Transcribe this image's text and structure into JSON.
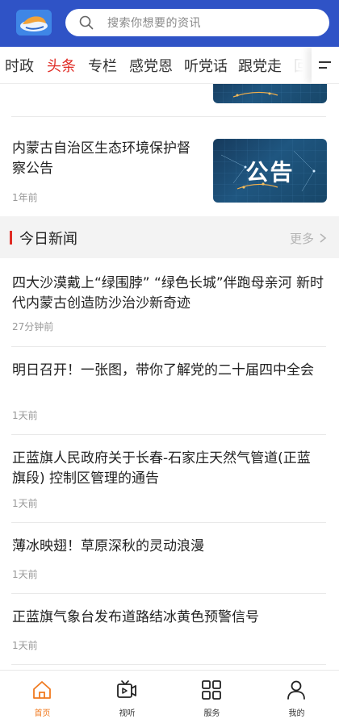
{
  "header": {
    "logo_icon": "app-logo",
    "search_placeholder": "搜索你想要的资讯",
    "search_icon": "search-icon"
  },
  "tabs": [
    {
      "label": "时政",
      "active": false
    },
    {
      "label": "头条",
      "active": true
    },
    {
      "label": "专栏",
      "active": false
    },
    {
      "label": "感党恩",
      "active": false
    },
    {
      "label": "听党话",
      "active": false
    },
    {
      "label": "跟党走",
      "active": false
    },
    {
      "label": "回",
      "active": false
    }
  ],
  "top_items": [
    {
      "title": "内蒙古自治区生态环境保护督察公告",
      "time": "1年前",
      "thumb_text": "公告"
    }
  ],
  "section": {
    "title": "今日新闻",
    "more_label": "更多"
  },
  "news": [
    {
      "title": "四大沙漠戴上“绿围脖” “绿色长城”伴跑母亲河  新时代内蒙古创造防沙治沙新奇迹",
      "time": "27分钟前"
    },
    {
      "title": "明日召开！一张图，带你了解党的二十届四中全会",
      "time": "1天前"
    },
    {
      "title": "正蓝旗人民政府关于长春-石家庄天然气管道(正蓝旗段) 控制区管理的通告",
      "time": "1天前"
    },
    {
      "title": "薄冰映翅！草原深秋的灵动浪漫",
      "time": "1天前"
    },
    {
      "title": "正蓝旗气象台发布道路结冰黄色预警信号",
      "time": "1天前"
    }
  ],
  "bottom_nav": [
    {
      "label": "首页",
      "icon": "home-icon",
      "active": true
    },
    {
      "label": "视听",
      "icon": "tv-icon",
      "active": false
    },
    {
      "label": "服务",
      "icon": "grid-icon",
      "active": false
    },
    {
      "label": "我的",
      "icon": "user-icon",
      "active": false
    }
  ],
  "colors": {
    "header": "#2f53c6",
    "accent_red": "#e02c25",
    "nav_active": "#f07a1f"
  }
}
